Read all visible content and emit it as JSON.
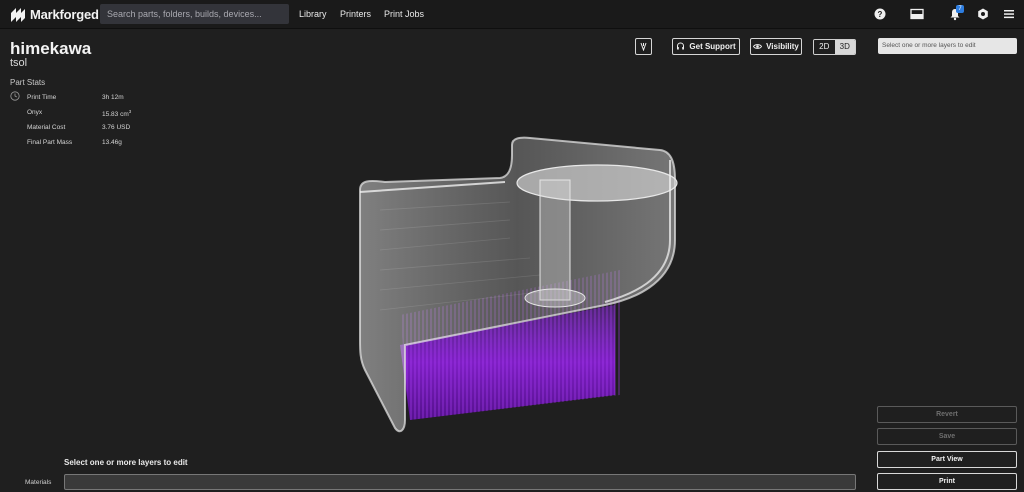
{
  "nav": {
    "brand": "Markforged",
    "search_placeholder": "Search parts, folders, builds, devices...",
    "links": [
      "Library",
      "Printers",
      "Print Jobs"
    ],
    "notification_count": "7",
    "icons": [
      "help-icon",
      "display-icon",
      "bell-icon",
      "settings-icon",
      "menu-icon"
    ]
  },
  "part": {
    "name": "himekawa",
    "subtitle": "tsol"
  },
  "stats": {
    "heading": "Part Stats",
    "rows": [
      {
        "label": "Print Time",
        "value": "3h 12m"
      },
      {
        "label": "Onyx",
        "value": "15.83 cm",
        "sup": "3"
      },
      {
        "label": "Material Cost",
        "value": "3.76 USD"
      },
      {
        "label": "Final Part Mass",
        "value": "13.46g"
      }
    ]
  },
  "toolbar": {
    "get_support": "Get Support",
    "visibility": "Visibility",
    "view_2d": "2D",
    "view_3d": "3D",
    "layer_select": "Select one or more layers to edit"
  },
  "bottom": {
    "prompt": "Select one or more layers to edit",
    "materials_label": "Materials"
  },
  "actions": {
    "revert": "Revert",
    "save": "Save",
    "part_view": "Part View",
    "print": "Print"
  },
  "colors": {
    "background": "#1f1f1f",
    "accent_purple": "#8a2be2",
    "badge_blue": "#2d7de0"
  }
}
